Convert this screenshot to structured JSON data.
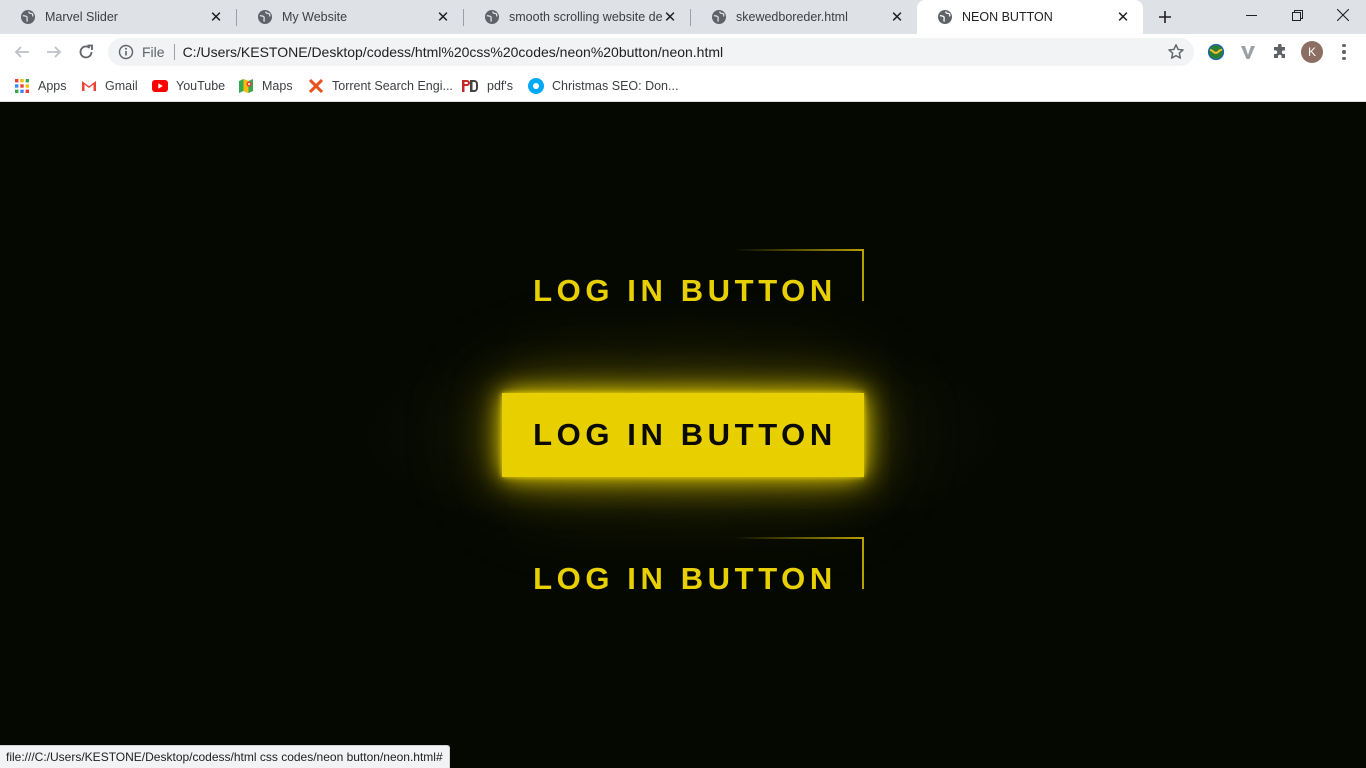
{
  "browser": {
    "tabs": [
      {
        "title": "Marvel Slider",
        "active": false
      },
      {
        "title": "My Website",
        "active": false
      },
      {
        "title": "smooth scrolling website design",
        "active": false
      },
      {
        "title": "skewedboreder.html",
        "active": false
      },
      {
        "title": "NEON BUTTON",
        "active": true
      }
    ],
    "new_tab_icon": "plus-icon",
    "window_controls": [
      "minimize-icon",
      "restore-icon",
      "close-icon"
    ],
    "address": {
      "scheme_label": "File",
      "url": "C:/Users/KESTONE/Desktop/codess/html%20css%20codes/neon%20button/neon.html"
    },
    "profile_initial": "K",
    "bookmarks": [
      {
        "label": "Apps",
        "icon": "apps-grid-icon"
      },
      {
        "label": "Gmail",
        "icon": "gmail-icon"
      },
      {
        "label": "YouTube",
        "icon": "youtube-icon"
      },
      {
        "label": "Maps",
        "icon": "maps-icon"
      },
      {
        "label": "Torrent Search Engi...",
        "icon": "torrent-icon"
      },
      {
        "label": "pdf's",
        "icon": "pdf-icon"
      },
      {
        "label": "Christmas SEO: Don...",
        "icon": "seo-icon"
      }
    ],
    "status_text": "file:///C:/Users/KESTONE/Desktop/codess/html css codes/neon button/neon.html#"
  },
  "page": {
    "buttons": [
      {
        "label": "LOG IN BUTTON",
        "state": "normal"
      },
      {
        "label": "LOG IN BUTTON",
        "state": "hover"
      },
      {
        "label": "LOG IN BUTTON",
        "state": "normal"
      }
    ]
  },
  "colors": {
    "neon": "#e8d000",
    "background": "#050800",
    "chrome_tabstrip": "#dee1e6"
  }
}
